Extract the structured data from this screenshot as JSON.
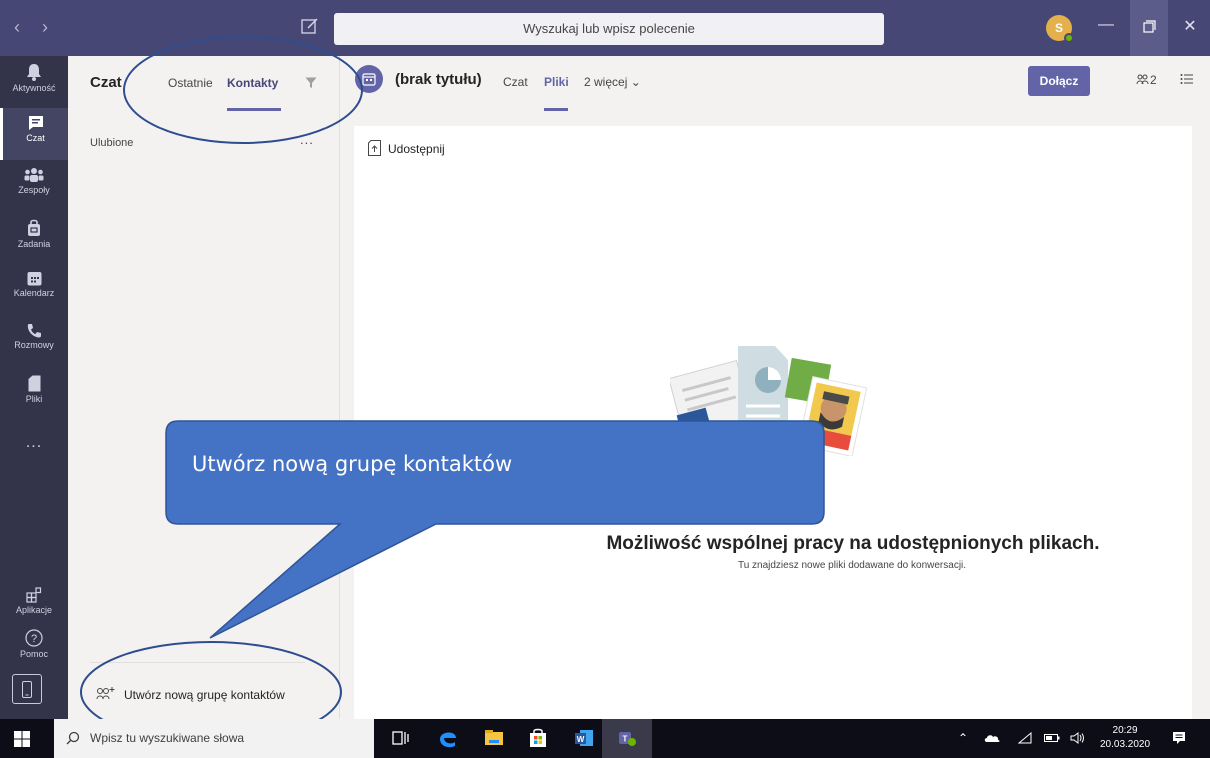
{
  "titlebar": {
    "search_placeholder": "Wyszukaj lub wpisz polecenie",
    "avatar_initial": "S"
  },
  "rail": {
    "items": [
      {
        "label": "Aktywność",
        "icon": "bell-icon"
      },
      {
        "label": "Czat",
        "icon": "chat-icon"
      },
      {
        "label": "Zespoły",
        "icon": "teams-icon"
      },
      {
        "label": "Zadania",
        "icon": "assignments-icon"
      },
      {
        "label": "Kalendarz",
        "icon": "calendar-icon"
      },
      {
        "label": "Rozmowy",
        "icon": "phone-icon"
      },
      {
        "label": "Pliki",
        "icon": "file-icon"
      }
    ],
    "more": "...",
    "apps_label": "Aplikacje",
    "help_label": "Pomoc"
  },
  "chatpane": {
    "title": "Czat",
    "tab_recent": "Ostatnie",
    "tab_contacts": "Kontakty",
    "favorites": "Ulubione",
    "more": "...",
    "new_group_label": "Utwórz nową grupę kontaktów"
  },
  "conversation": {
    "title": "(brak tytułu)",
    "tab_chat": "Czat",
    "tab_files": "Pliki",
    "tab_more": "2 więcej",
    "join_label": "Dołącz",
    "participants_count": "2"
  },
  "files": {
    "share_label": "Udostępnij",
    "empty_title": "Możliwość wspólnej pracy na udostępnionych plikach.",
    "empty_subtitle": "Tu znajdziesz nowe pliki dodawane do konwersacji."
  },
  "callout": {
    "text": "Utwórz nową grupę kontaktów"
  },
  "taskbar": {
    "search_placeholder": "Wpisz tu wyszukiwane słowa",
    "time": "20:29",
    "date": "20.03.2020"
  },
  "colors": {
    "titlebar": "#464775",
    "rail": "#33344a",
    "accent": "#6264a7",
    "callout": "#4472c4"
  }
}
